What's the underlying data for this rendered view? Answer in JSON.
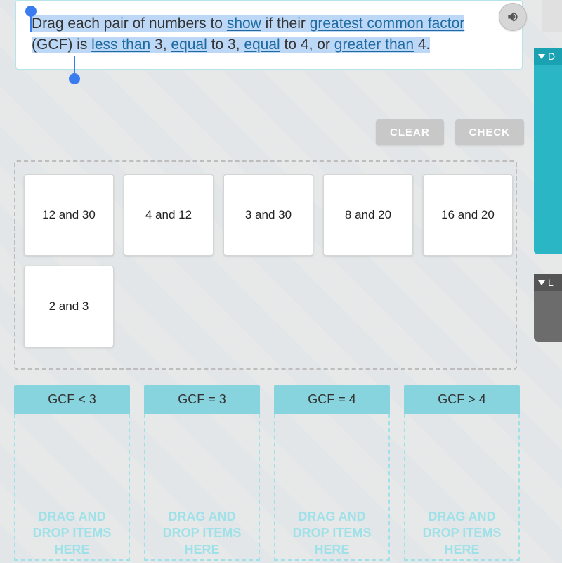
{
  "prompt": {
    "parts": [
      {
        "t": "Drag each pair of numbers to ",
        "sel": true
      },
      {
        "t": "show",
        "sel": true,
        "link": true
      },
      {
        "t": " if their ",
        "sel": true
      },
      {
        "t": "greatest common factor",
        "sel": true,
        "link": true
      },
      {
        "t": " (GCF) is ",
        "sel": true
      },
      {
        "t": "less than",
        "sel": true,
        "link": true
      },
      {
        "t": " 3, ",
        "sel": true
      },
      {
        "t": "equal",
        "sel": true,
        "link": true
      },
      {
        "t": " to 3, ",
        "sel": true
      },
      {
        "t": "equal",
        "sel": true,
        "link": true
      },
      {
        "t": " to 4, or ",
        "sel": true
      },
      {
        "t": "greater than",
        "sel": true,
        "link": true
      },
      {
        "t": " 4.",
        "sel": true
      }
    ]
  },
  "buttons": {
    "clear": "CLEAR",
    "check": "CHECK"
  },
  "cards": [
    "12 and 30",
    "4 and 12",
    "3 and 30",
    "8 and 20",
    "16 and 20",
    "2 and 3"
  ],
  "dropzones": [
    {
      "header": "GCF < 3",
      "placeholder": "DRAG AND DROP ITEMS HERE"
    },
    {
      "header": "GCF = 3",
      "placeholder": "DRAG AND DROP ITEMS HERE"
    },
    {
      "header": "GCF = 4",
      "placeholder": "DRAG AND DROP ITEMS HERE"
    },
    {
      "header": "GCF > 4",
      "placeholder": "DRAG AND DROP ITEMS HERE"
    }
  ],
  "side": {
    "tab1_letter": "D",
    "tab2_letter": "L"
  },
  "icons": {
    "audio": "speaker-icon"
  }
}
